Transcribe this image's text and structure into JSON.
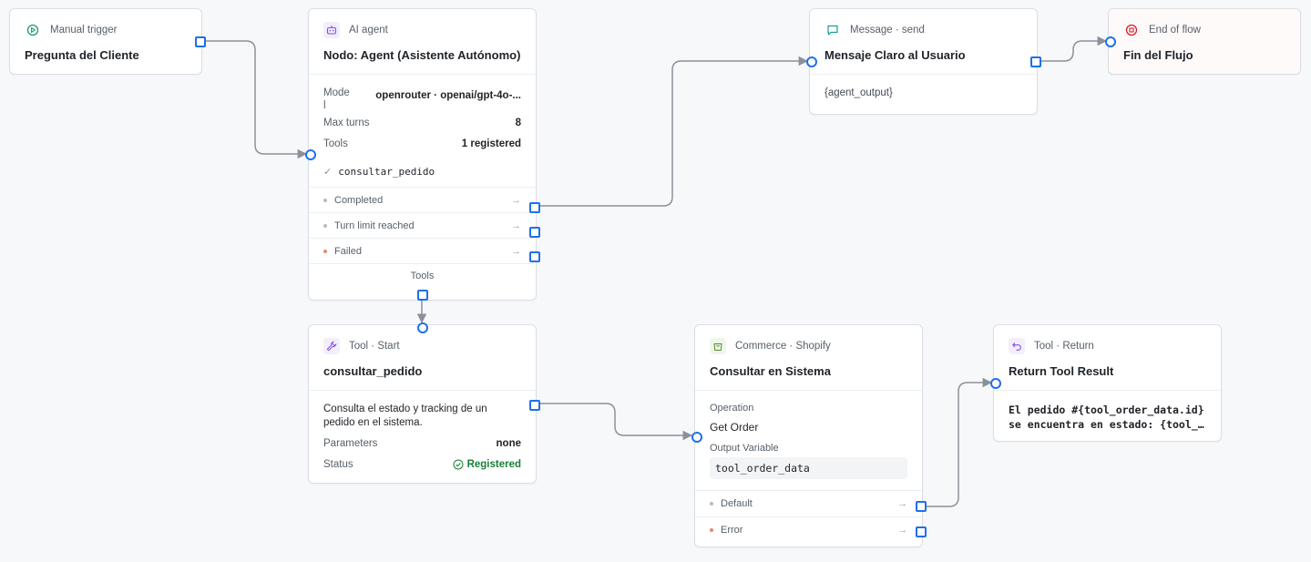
{
  "colors": {
    "accent": "#1f6feb",
    "wire": "#8c9199",
    "success": "#1a7f37",
    "error": "#e98a6c"
  },
  "trigger": {
    "kind": "Manual trigger",
    "title": "Pregunta del Cliente",
    "icon": "play-circle-icon"
  },
  "agent": {
    "kind": "AI agent",
    "title": "Nodo: Agent (Asistente Autónomo)",
    "icon": "robot-icon",
    "model_label": "Mode\nl",
    "model_value": "openrouter · openai/gpt-4o-...",
    "max_turns_label": "Max turns",
    "max_turns_value": "8",
    "tools_label": "Tools",
    "tools_value": "1 registered",
    "tool_item": "consultar_pedido",
    "outputs": [
      "Completed",
      "Turn limit reached",
      "Failed"
    ],
    "tools_port_label": "Tools"
  },
  "message": {
    "kind": "Message · send",
    "title": "Mensaje Claro al Usuario",
    "content": "{agent_output}",
    "icon": "chat-bubble-icon"
  },
  "end": {
    "kind": "End of flow",
    "title": "Fin del Flujo",
    "icon": "stop-circle-icon"
  },
  "tool_start": {
    "kind": "Tool · Start",
    "title": "consultar_pedido",
    "icon": "wrench-icon",
    "description": "Consulta el estado y tracking de un pedido en el sistema.",
    "parameters_label": "Parameters",
    "parameters_value": "none",
    "status_label": "Status",
    "status_value": "Registered"
  },
  "shopify": {
    "kind": "Commerce · Shopify",
    "title": "Consultar en Sistema",
    "icon": "shopping-bag-icon",
    "operation_label": "Operation",
    "operation_value": "Get Order",
    "output_var_label": "Output Variable",
    "output_var_value": "tool_order_data",
    "outputs": [
      "Default",
      "Error"
    ]
  },
  "tool_return": {
    "kind": "Tool · Return",
    "title": "Return Tool Result",
    "icon": "return-arrow-icon",
    "line1": "El pedido #{tool_order_data.id}",
    "line2": "se encuentra en estado: {tool_…"
  }
}
